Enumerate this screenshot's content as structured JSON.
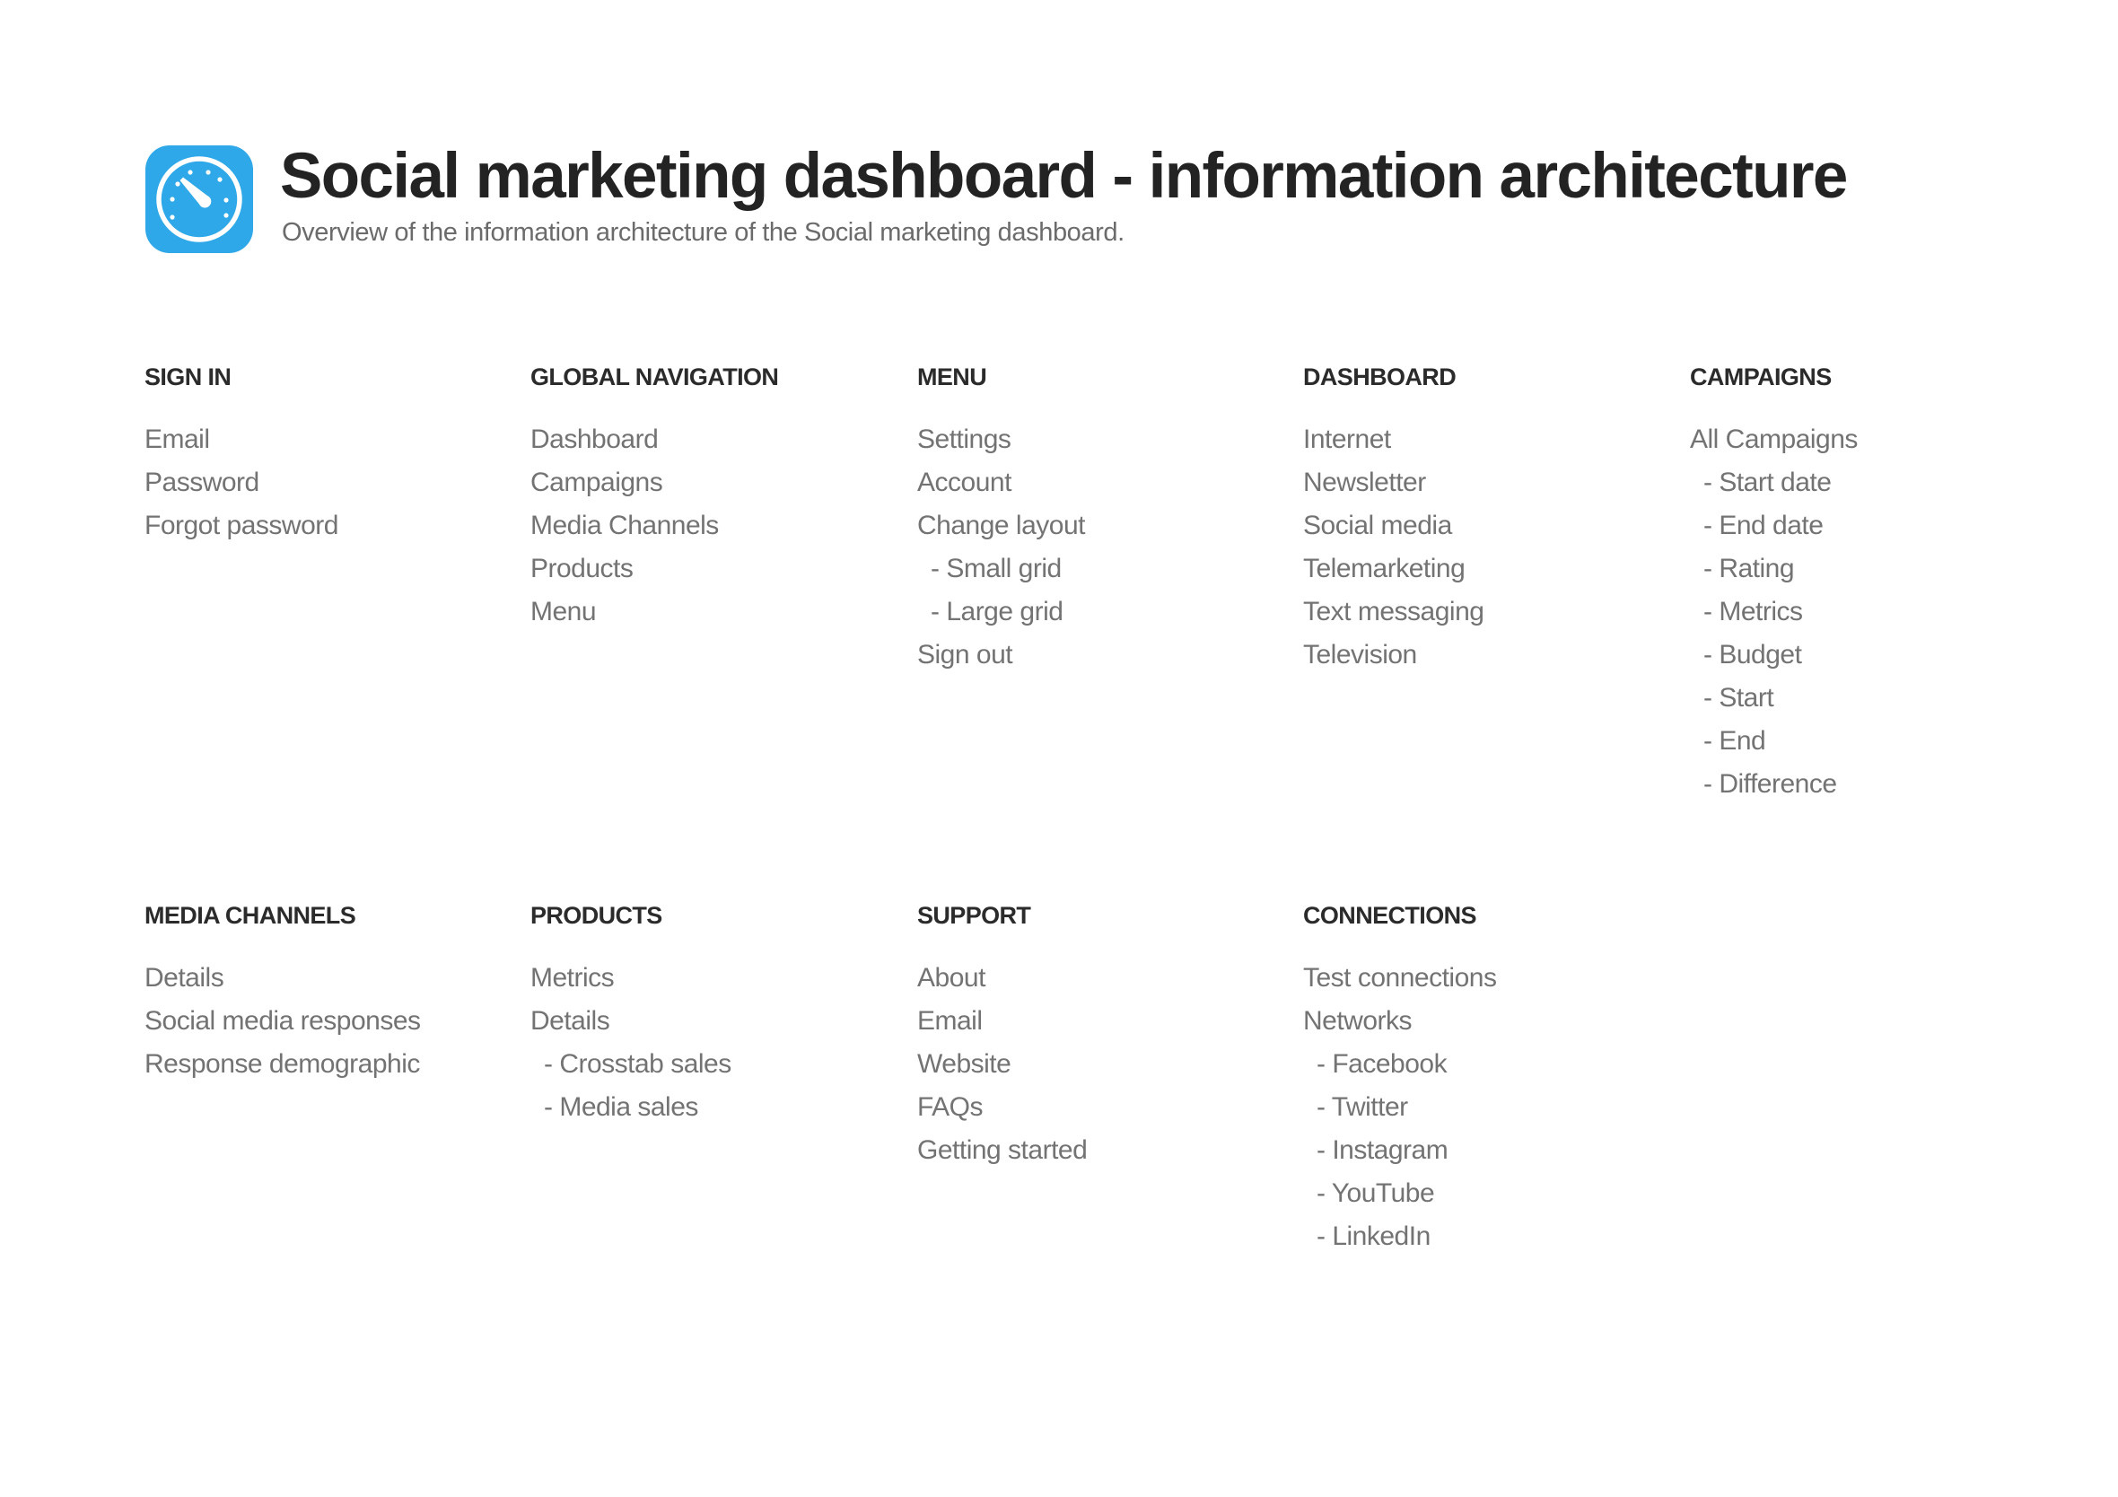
{
  "header": {
    "icon": "speedometer-gauge-icon",
    "icon_color": "#2ea8e8",
    "title": "Social marketing dashboard - information architecture",
    "subtitle": "Overview of the information architecture of the Social marketing dashboard."
  },
  "sections": [
    {
      "heading": "SIGN IN",
      "items": [
        {
          "label": "Email",
          "level": 0
        },
        {
          "label": "Password",
          "level": 0
        },
        {
          "label": "Forgot password",
          "level": 0
        }
      ]
    },
    {
      "heading": "GLOBAL NAVIGATION",
      "items": [
        {
          "label": "Dashboard",
          "level": 0
        },
        {
          "label": "Campaigns",
          "level": 0
        },
        {
          "label": "Media Channels",
          "level": 0
        },
        {
          "label": "Products",
          "level": 0
        },
        {
          "label": "Menu",
          "level": 0
        }
      ]
    },
    {
      "heading": "MENU",
      "items": [
        {
          "label": "Settings",
          "level": 0
        },
        {
          "label": "Account",
          "level": 0
        },
        {
          "label": "Change layout",
          "level": 0
        },
        {
          "label": "- Small grid",
          "level": 1
        },
        {
          "label": "- Large grid",
          "level": 1
        },
        {
          "label": "Sign out",
          "level": 0
        }
      ]
    },
    {
      "heading": "DASHBOARD",
      "items": [
        {
          "label": "Internet",
          "level": 0
        },
        {
          "label": "Newsletter",
          "level": 0
        },
        {
          "label": "Social media",
          "level": 0
        },
        {
          "label": "Telemarketing",
          "level": 0
        },
        {
          "label": "Text messaging",
          "level": 0
        },
        {
          "label": "Television",
          "level": 0
        }
      ]
    },
    {
      "heading": "CAMPAIGNS",
      "items": [
        {
          "label": "All Campaigns",
          "level": 0
        },
        {
          "label": "- Start date",
          "level": 1
        },
        {
          "label": "- End date",
          "level": 1
        },
        {
          "label": "- Rating",
          "level": 1
        },
        {
          "label": "- Metrics",
          "level": 1
        },
        {
          "label": "- Budget",
          "level": 1
        },
        {
          "label": "- Start",
          "level": 1
        },
        {
          "label": "- End",
          "level": 1
        },
        {
          "label": "- Difference",
          "level": 1
        }
      ]
    },
    {
      "heading": "MEDIA CHANNELS",
      "items": [
        {
          "label": "Details",
          "level": 0
        },
        {
          "label": "Social media responses",
          "level": 0
        },
        {
          "label": "Response demographic",
          "level": 0
        }
      ]
    },
    {
      "heading": "PRODUCTS",
      "items": [
        {
          "label": "Metrics",
          "level": 0
        },
        {
          "label": "Details",
          "level": 0
        },
        {
          "label": "- Crosstab sales",
          "level": 1
        },
        {
          "label": "- Media sales",
          "level": 1
        }
      ]
    },
    {
      "heading": "SUPPORT",
      "items": [
        {
          "label": "About",
          "level": 0
        },
        {
          "label": "Email",
          "level": 0
        },
        {
          "label": "Website",
          "level": 0
        },
        {
          "label": "FAQs",
          "level": 0
        },
        {
          "label": "Getting started",
          "level": 0
        }
      ]
    },
    {
      "heading": "CONNECTIONS",
      "items": [
        {
          "label": "Test connections",
          "level": 0
        },
        {
          "label": "Networks",
          "level": 0
        },
        {
          "label": "- Facebook",
          "level": 1
        },
        {
          "label": "- Twitter",
          "level": 1
        },
        {
          "label": "- Instagram",
          "level": 1
        },
        {
          "label": "- YouTube",
          "level": 1
        },
        {
          "label": "- LinkedIn",
          "level": 1
        }
      ]
    }
  ]
}
